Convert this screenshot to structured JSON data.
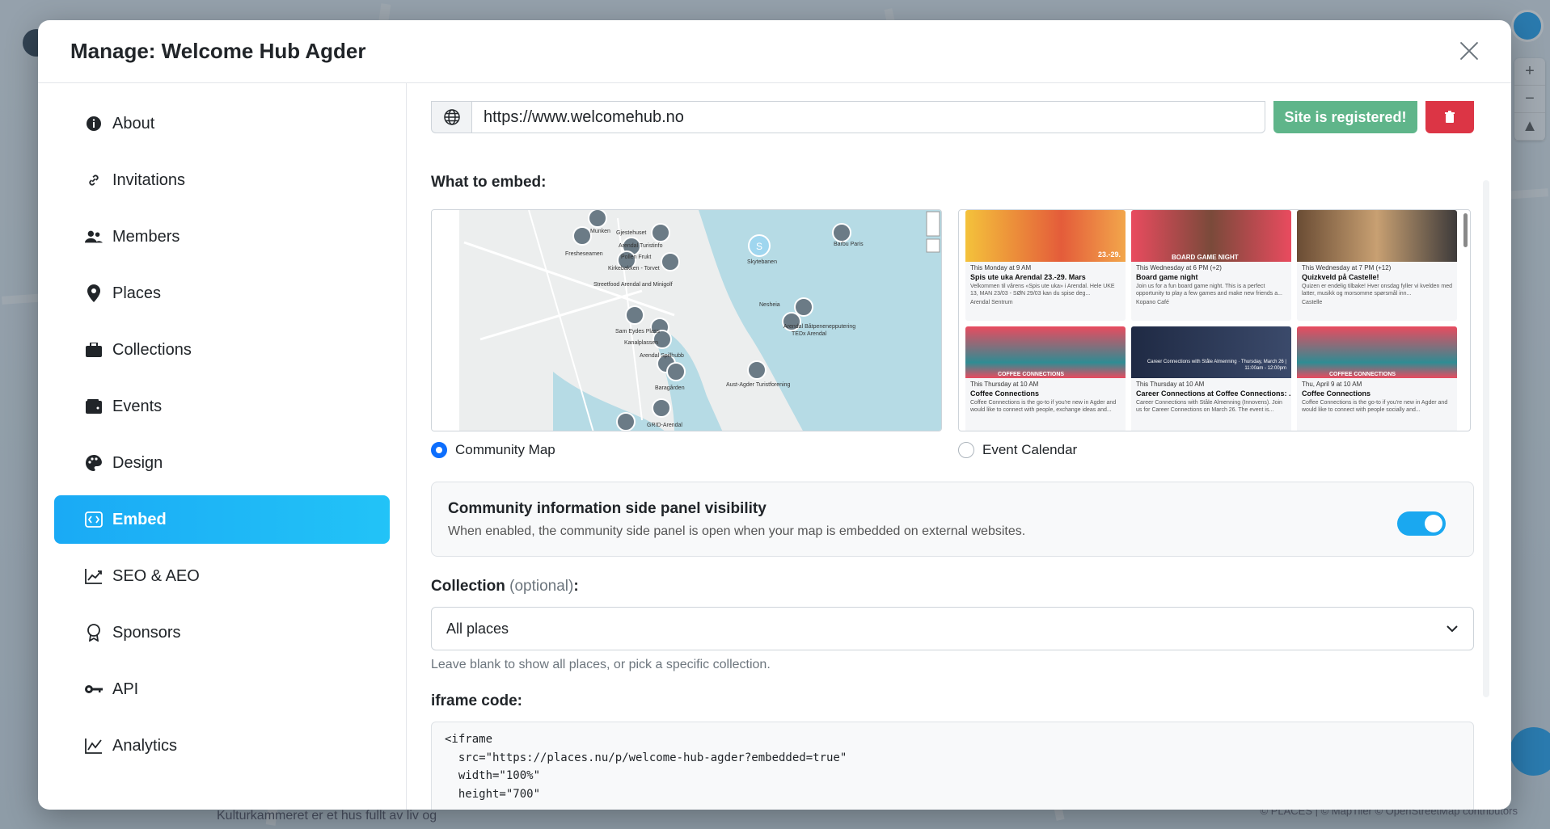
{
  "modal": {
    "title": "Manage: Welcome Hub Agder"
  },
  "sidebar": {
    "items": [
      {
        "label": "About",
        "icon": "info-icon"
      },
      {
        "label": "Invitations",
        "icon": "link-icon"
      },
      {
        "label": "Members",
        "icon": "users-icon"
      },
      {
        "label": "Places",
        "icon": "map-pin-icon"
      },
      {
        "label": "Collections",
        "icon": "briefcase-icon"
      },
      {
        "label": "Events",
        "icon": "wallet-icon"
      },
      {
        "label": "Design",
        "icon": "palette-icon"
      },
      {
        "label": "Embed",
        "icon": "code-icon",
        "active": true
      },
      {
        "label": "SEO & AEO",
        "icon": "trend-icon"
      },
      {
        "label": "Sponsors",
        "icon": "award-icon"
      },
      {
        "label": "API",
        "icon": "key-icon"
      },
      {
        "label": "Analytics",
        "icon": "chart-line-icon"
      }
    ]
  },
  "embed": {
    "site_url": "https://www.welcomehub.no",
    "site_status": "Site is registered!",
    "what_to_embed_label": "What to embed:",
    "options": {
      "map": "Community Map",
      "calendar": "Event Calendar",
      "selected": "map"
    },
    "map_labels": [
      "Munken",
      "Gjestehuset",
      "Fresheseamen",
      "Arendal Turistinfo",
      "Pollen Frukt",
      "Kirkebakken - Torvet",
      "Streetfood Arendal and Minigolf",
      "Skytebanen",
      "Barbu Paris",
      "Sam Eydes Plass",
      "Kanalplassen",
      "Arendal Spillhubb",
      "Baragården",
      "Aust-Agder Turistforening",
      "Arendal Båtpenenepputering",
      "TEDx Arendal",
      "Nesheia",
      "GRID-Arendal"
    ],
    "calendar_events": [
      {
        "when": "This Monday at 9 AM",
        "title": "Spis ute uka Arendal 23.-29. Mars",
        "desc": "Velkommen til vårens «Spis ute uka» i Arendal. Hele UKE 13, MAN 23/03 - SØN 29/03 kan du spise deg...",
        "venue": "Arendal Sentrum",
        "banner": "23.-29."
      },
      {
        "when": "This Wednesday at 6 PM (+2)",
        "title": "Board game night",
        "desc": "Join us for a fun board game night. This is a perfect opportunity to play a few games and make new friends a...",
        "venue": "Kopano Café",
        "banner": "BOARD GAME NIGHT"
      },
      {
        "when": "This Wednesday at 7 PM (+12)",
        "title": "Quizkveld på Castelle!",
        "desc": "Quizen er endelig tilbake! Hver onsdag fyller vi kvelden med latter, musikk og morsomme spørsmål inn...",
        "venue": "Castelle",
        "banner": ""
      },
      {
        "when": "This Thursday at 10 AM",
        "title": "Coffee Connections",
        "desc": "Coffee Connections is the go-to if you're new in Agder and would like to connect with people, exchange ideas and...",
        "venue": "",
        "banner": "COFFEE CONNECTIONS"
      },
      {
        "when": "This Thursday at 10 AM",
        "title": "Career Connections at Coffee Connections: ...",
        "desc": "Career Connections with Ståle Almenning (Innovens). Join us for Career Connections on March 26. The event is...",
        "venue": "",
        "banner": "Career Connections with Ståle Almenning · Thursday, March 26 | 11:00am - 12:00pm"
      },
      {
        "when": "Thu, April 9 at 10 AM",
        "title": "Coffee Connections",
        "desc": "Coffee Connections is the go-to if you're new in Agder and would like to connect with people socially and...",
        "venue": "",
        "banner": "COFFEE CONNECTIONS"
      }
    ],
    "side_panel": {
      "title": "Community information side panel visibility",
      "description": "When enabled, the community side panel is open when your map is embedded on external websites.",
      "enabled": true
    },
    "collection": {
      "label": "Collection",
      "optional": "(optional)",
      "colon": ":",
      "selected": "All places",
      "helper": "Leave blank to show all places, or pick a specific collection."
    },
    "iframe": {
      "label": "iframe code:",
      "code": "<iframe\n  src=\"https://places.nu/p/welcome-hub-agder?embedded=true\"\n  width=\"100%\"\n  height=\"700\""
    }
  },
  "background": {
    "footer_text": "Kulturkammeret er et hus fullt av liv og",
    "attribution": "© PLACES | © MapTiler © OpenStreetMap contributors"
  },
  "colors": {
    "accent": "#1aaaf5",
    "success": "#5fb58a",
    "danger": "#dc3545",
    "radio": "#0d6efd"
  }
}
